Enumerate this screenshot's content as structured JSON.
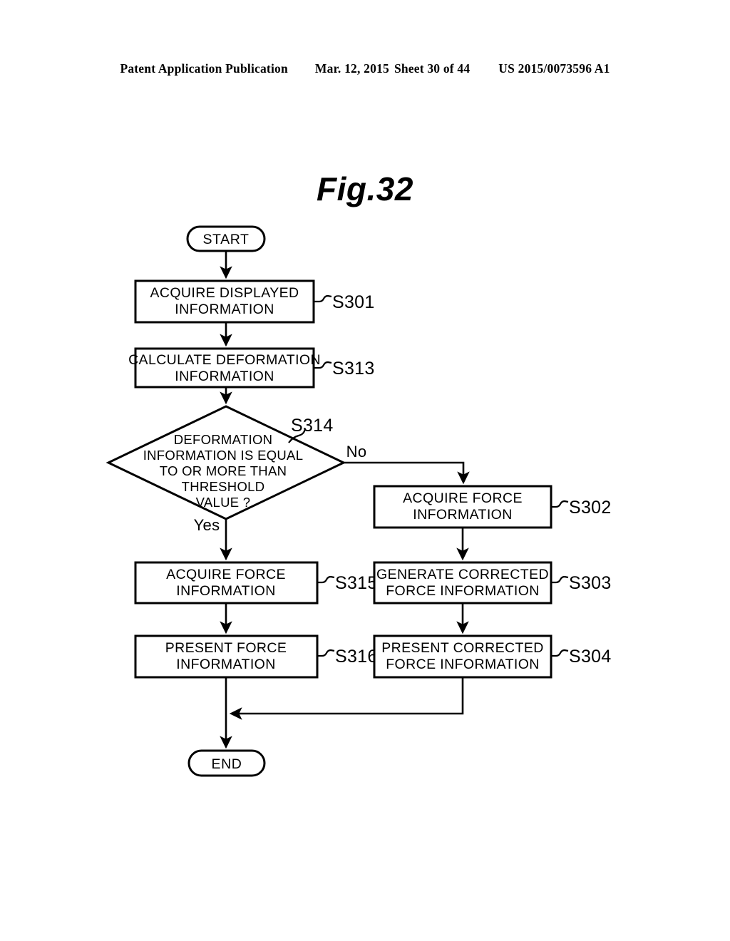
{
  "header": {
    "publication": "Patent Application Publication",
    "date": "Mar. 12, 2015",
    "sheet": "Sheet 30 of 44",
    "doc_number": "US 2015/0073596 A1"
  },
  "figure": {
    "title": "Fig.32"
  },
  "diagram": {
    "type": "flowchart",
    "start_label": "START",
    "end_label": "END",
    "nodes": [
      {
        "id": "start",
        "shape": "terminator",
        "text": "START",
        "step": ""
      },
      {
        "id": "s301",
        "shape": "process",
        "line1": "ACQUIRE  DISPLAYED",
        "line2": "INFORMATION",
        "step": "S301"
      },
      {
        "id": "s313",
        "shape": "process",
        "line1": "CALCULATE  DEFORMATION",
        "line2": "INFORMATION",
        "step": "S313"
      },
      {
        "id": "s314",
        "shape": "decision",
        "line1": "DEFORMATION",
        "line2": "INFORMATION  IS  EQUAL",
        "line3": "TO  OR  MORE  THAN",
        "line4": "THRESHOLD",
        "line5": "VALUE ?",
        "step": "S314",
        "yes_label": "Yes",
        "no_label": "No"
      },
      {
        "id": "s315",
        "shape": "process",
        "line1": "ACQUIRE  FORCE",
        "line2": "INFORMATION",
        "step": "S315"
      },
      {
        "id": "s316",
        "shape": "process",
        "line1": "PRESENT  FORCE",
        "line2": "INFORMATION",
        "step": "S316"
      },
      {
        "id": "s302",
        "shape": "process",
        "line1": "ACQUIRE  FORCE",
        "line2": "INFORMATION",
        "step": "S302"
      },
      {
        "id": "s303",
        "shape": "process",
        "line1": "GENERATE  CORRECTED",
        "line2": "FORCE  INFORMATION",
        "step": "S303"
      },
      {
        "id": "s304",
        "shape": "process",
        "line1": "PRESENT  CORRECTED",
        "line2": "FORCE  INFORMATION",
        "step": "S304"
      },
      {
        "id": "end",
        "shape": "terminator",
        "text": "END",
        "step": ""
      }
    ],
    "colors": {
      "ink": "#000000",
      "paper": "#ffffff"
    }
  }
}
